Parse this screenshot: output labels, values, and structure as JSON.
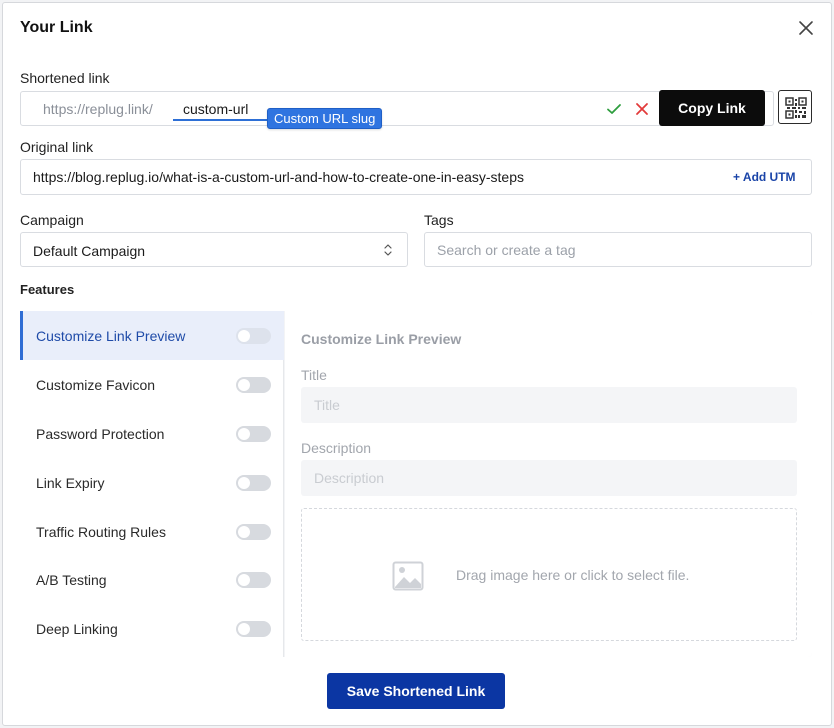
{
  "dialog": {
    "title": "Your Link",
    "close_icon": "close-icon"
  },
  "shortened": {
    "label": "Shortened link",
    "domain": "https://replug.link/",
    "slug": "custom-url",
    "tooltip": "Custom URL slug",
    "confirm_icon": "checkmark-icon",
    "cancel_icon": "cross-icon",
    "copy_label": "Copy Link",
    "qr_icon": "qr-code-icon",
    "colors": {
      "confirm": "#2e9e3e",
      "cancel": "#e23a3a",
      "tooltip": "#2f74e0"
    }
  },
  "original": {
    "label": "Original link",
    "value": "https://blog.replug.io/what-is-a-custom-url-and-how-to-create-one-in-easy-steps",
    "add_utm": "+ Add UTM"
  },
  "campaign": {
    "label": "Campaign",
    "value": "Default Campaign"
  },
  "tags": {
    "label": "Tags",
    "placeholder": "Search or create a tag"
  },
  "features": {
    "label": "Features",
    "items": [
      {
        "label": "Customize Link Preview",
        "enabled": false,
        "active": true
      },
      {
        "label": "Customize Favicon",
        "enabled": false
      },
      {
        "label": "Password Protection",
        "enabled": false
      },
      {
        "label": "Link Expiry",
        "enabled": false
      },
      {
        "label": "Traffic Routing Rules",
        "enabled": false
      },
      {
        "label": "A/B Testing",
        "enabled": false
      },
      {
        "label": "Deep Linking",
        "enabled": false
      }
    ],
    "panel": {
      "heading": "Customize Link Preview",
      "title_label": "Title",
      "title_placeholder": "Title",
      "description_label": "Description",
      "description_placeholder": "Description",
      "dropzone_text": "Drag image here or click to select file.",
      "dropzone_icon": "image-icon"
    }
  },
  "footer": {
    "save_label": "Save Shortened Link"
  },
  "theme": {
    "primary": "#0b36a3",
    "accent": "#2f6dd4",
    "dark_button": "#0c0c0c"
  }
}
